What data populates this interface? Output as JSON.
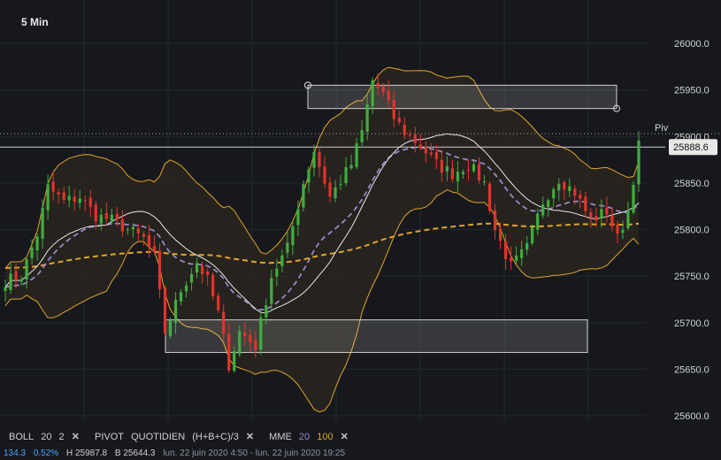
{
  "header": {
    "timeframe": "5 Min"
  },
  "chart_data": {
    "type": "candlestick",
    "ylim": [
      25600,
      26000
    ],
    "y_ticks": [
      "26000.0",
      "25950.0",
      "25900.0",
      "25850.0",
      "25800.0",
      "25750.0",
      "25700.0",
      "25650.0",
      "25600.0"
    ],
    "y_tick_values": [
      26000,
      25950,
      25900,
      25850,
      25800,
      25750,
      25700,
      25650,
      25600
    ],
    "current_price_label": "25888.6",
    "current_price": 25888.6,
    "pivot_label": "Piv",
    "pivot_value": 25903,
    "bar_count": 120,
    "anchors": [
      [
        0,
        25745
      ],
      [
        3,
        25750
      ],
      [
        6,
        25795
      ],
      [
        8,
        25845
      ],
      [
        11,
        25830
      ],
      [
        14,
        25835
      ],
      [
        17,
        25815
      ],
      [
        20,
        25810
      ],
      [
        23,
        25800
      ],
      [
        26,
        25790
      ],
      [
        28,
        25770
      ],
      [
        30,
        25690
      ],
      [
        33,
        25735
      ],
      [
        36,
        25765
      ],
      [
        38,
        25745
      ],
      [
        40,
        25710
      ],
      [
        42,
        25655
      ],
      [
        44,
        25690
      ],
      [
        47,
        25675
      ],
      [
        50,
        25750
      ],
      [
        53,
        25780
      ],
      [
        56,
        25850
      ],
      [
        58,
        25885
      ],
      [
        61,
        25835
      ],
      [
        65,
        25870
      ],
      [
        67,
        25905
      ],
      [
        69,
        25960
      ],
      [
        71,
        25945
      ],
      [
        73,
        25920
      ],
      [
        75,
        25905
      ],
      [
        78,
        25890
      ],
      [
        81,
        25870
      ],
      [
        84,
        25860
      ],
      [
        87,
        25870
      ],
      [
        90,
        25850
      ],
      [
        92,
        25800
      ],
      [
        95,
        25760
      ],
      [
        98,
        25780
      ],
      [
        101,
        25830
      ],
      [
        104,
        25855
      ],
      [
        107,
        25840
      ],
      [
        110,
        25810
      ],
      [
        113,
        25820
      ],
      [
        115,
        25790
      ],
      [
        117,
        25820
      ],
      [
        119,
        25890
      ]
    ],
    "series": [
      {
        "name": "BOLL upper"
      },
      {
        "name": "BOLL lower"
      },
      {
        "name": "MME 20",
        "color": "#9b86c8"
      },
      {
        "name": "MME 100",
        "color": "#e3a32a"
      }
    ],
    "zones": [
      {
        "y_top": 25955,
        "y_bottom": 25930
      },
      {
        "y_top": 25703,
        "y_bottom": 25668
      }
    ]
  },
  "legend": {
    "boll_label": "BOLL",
    "boll_period": "20",
    "boll_dev": "2",
    "pivot_label": "PIVOT",
    "pivot_period": "QUOTIDIEN",
    "pivot_formula": "(H+B+C)/3",
    "mme_label": "MME",
    "mme_fast": "20",
    "mme_slow": "100",
    "close_glyph": "✕"
  },
  "stats": {
    "change": "134.3",
    "change_pct": "0.52%",
    "high": "H 25987.8",
    "low": "B 25644.3",
    "range": "lun. 22 juin 2020 4:50 - lun. 22 juin 2020 19:25"
  },
  "colors": {
    "background": "#16181d",
    "bull": "#3fae3f",
    "bear": "#e2332b",
    "boll_band": "#e0a526",
    "boll_fill": "#2a2720",
    "ma_white": "#e8e8e8",
    "mme_fast": "#9b86c8",
    "mme_slow": "#e3a32a",
    "change_blue": "#4da3ff"
  }
}
